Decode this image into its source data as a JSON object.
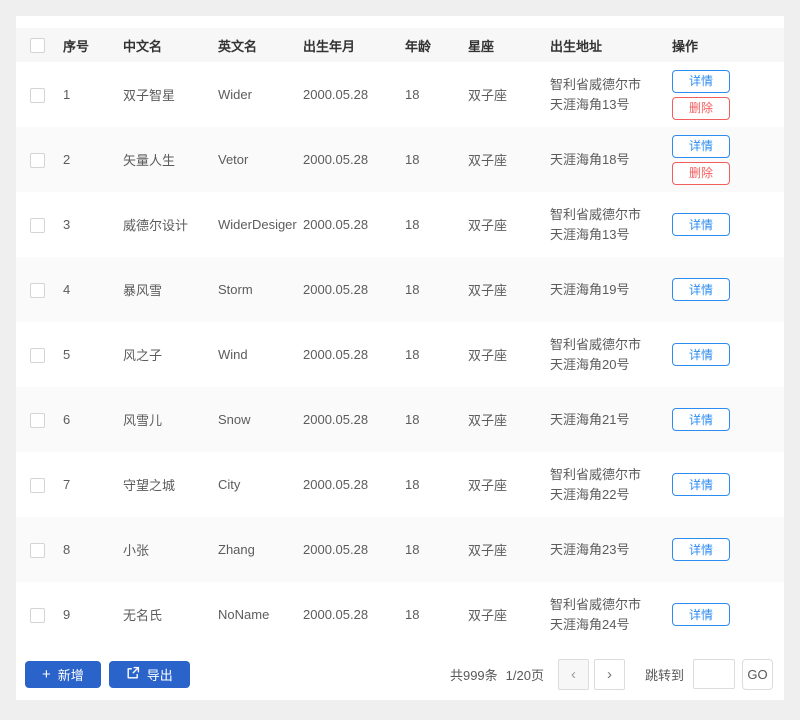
{
  "table": {
    "columns": [
      {
        "key": "index",
        "label": "序号"
      },
      {
        "key": "cn_name",
        "label": "中文名"
      },
      {
        "key": "en_name",
        "label": "英文名"
      },
      {
        "key": "birth",
        "label": "出生年月"
      },
      {
        "key": "age",
        "label": "年龄"
      },
      {
        "key": "zodiac",
        "label": "星座"
      },
      {
        "key": "address",
        "label": "出生地址"
      },
      {
        "key": "actions",
        "label": "操作"
      }
    ],
    "action_labels": {
      "detail": "详情",
      "delete": "删除"
    },
    "rows": [
      {
        "index": "1",
        "cn_name": "双子智星",
        "en_name": "Wider",
        "birth": "2000.05.28",
        "age": "18",
        "zodiac": "双子座",
        "address_lines": [
          "智利省威德尔市",
          "天涯海角13号"
        ],
        "actions": [
          "detail",
          "delete"
        ]
      },
      {
        "index": "2",
        "cn_name": "矢量人生",
        "en_name": "Vetor",
        "birth": "2000.05.28",
        "age": "18",
        "zodiac": "双子座",
        "address_lines": [
          "天涯海角18号"
        ],
        "actions": [
          "detail",
          "delete"
        ]
      },
      {
        "index": "3",
        "cn_name": "威德尔设计",
        "en_name": "WiderDesiger",
        "birth": "2000.05.28",
        "age": "18",
        "zodiac": "双子座",
        "address_lines": [
          "智利省威德尔市",
          "天涯海角13号"
        ],
        "actions": [
          "detail"
        ]
      },
      {
        "index": "4",
        "cn_name": "暴风雪",
        "en_name": "Storm",
        "birth": "2000.05.28",
        "age": "18",
        "zodiac": "双子座",
        "address_lines": [
          "天涯海角19号"
        ],
        "actions": [
          "detail"
        ]
      },
      {
        "index": "5",
        "cn_name": "风之子",
        "en_name": "Wind",
        "birth": "2000.05.28",
        "age": "18",
        "zodiac": "双子座",
        "address_lines": [
          "智利省威德尔市",
          "天涯海角20号"
        ],
        "actions": [
          "detail"
        ]
      },
      {
        "index": "6",
        "cn_name": "风雪儿",
        "en_name": "Snow",
        "birth": "2000.05.28",
        "age": "18",
        "zodiac": "双子座",
        "address_lines": [
          "天涯海角21号"
        ],
        "actions": [
          "detail"
        ]
      },
      {
        "index": "7",
        "cn_name": "守望之城",
        "en_name": "City",
        "birth": "2000.05.28",
        "age": "18",
        "zodiac": "双子座",
        "address_lines": [
          "智利省威德尔市",
          "天涯海角22号"
        ],
        "actions": [
          "detail"
        ]
      },
      {
        "index": "8",
        "cn_name": "小张",
        "en_name": "Zhang",
        "birth": "2000.05.28",
        "age": "18",
        "zodiac": "双子座",
        "address_lines": [
          "天涯海角23号"
        ],
        "actions": [
          "detail"
        ]
      },
      {
        "index": "9",
        "cn_name": "无名氏",
        "en_name": "NoName",
        "birth": "2000.05.28",
        "age": "18",
        "zodiac": "双子座",
        "address_lines": [
          "智利省威德尔市",
          "天涯海角24号"
        ],
        "actions": [
          "detail"
        ]
      }
    ]
  },
  "footer": {
    "add_label": "新增",
    "export_label": "导出",
    "total_text": "共999条",
    "page_text": "1/20页",
    "prev_glyph": "‹",
    "next_glyph": "›",
    "jump_label": "跳转到",
    "jump_value": "",
    "go_label": "GO",
    "plus_glyph": "+"
  },
  "colors": {
    "page_bg": "#efefef",
    "header_bg": "#f7f7f7",
    "stripe_bg": "#fafafa",
    "primary_button_blue": "#2a63c9",
    "outline_button_blue": "#2d8cf0",
    "outline_button_red": "#f25e5e"
  }
}
